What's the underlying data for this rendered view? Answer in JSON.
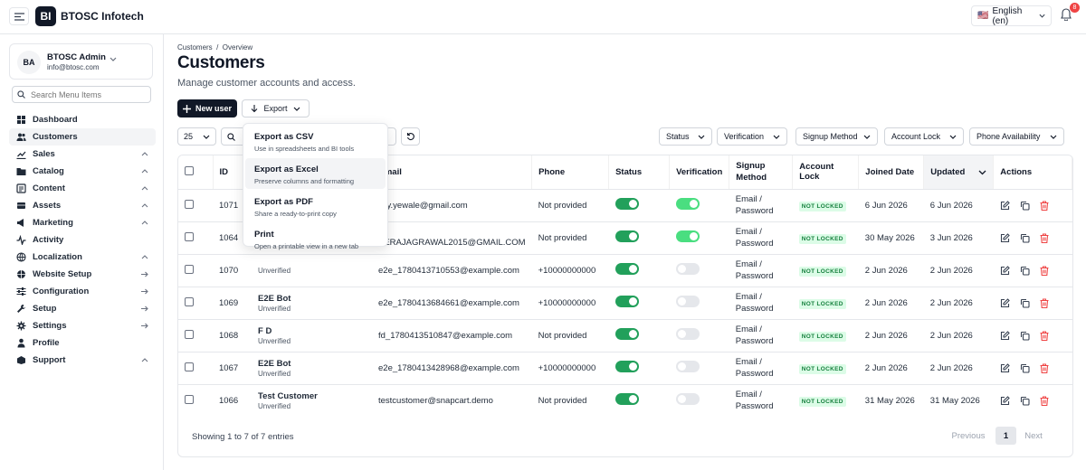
{
  "header": {
    "brand_logo": "BI",
    "brand_name": "BTOSC Infotech",
    "language": "English (en)",
    "flag": "🇺🇸",
    "notification_count": "8"
  },
  "sidebar": {
    "user": {
      "initials": "BA",
      "name": "BTOSC Admin",
      "email": "info@btosc.com"
    },
    "search_placeholder": "Search Menu Items",
    "items": [
      {
        "label": "Dashboard",
        "icon": "dashboard-icon",
        "arrow": ""
      },
      {
        "label": "Customers",
        "icon": "users-icon",
        "arrow": "",
        "active": true
      },
      {
        "label": "Sales",
        "icon": "chart-icon",
        "arrow": "up"
      },
      {
        "label": "Catalog",
        "icon": "folder-icon",
        "arrow": "up"
      },
      {
        "label": "Content",
        "icon": "content-icon",
        "arrow": "up"
      },
      {
        "label": "Assets",
        "icon": "assets-icon",
        "arrow": "up"
      },
      {
        "label": "Marketing",
        "icon": "megaphone-icon",
        "arrow": "up"
      },
      {
        "label": "Activity",
        "icon": "activity-icon",
        "arrow": ""
      },
      {
        "label": "Localization",
        "icon": "globe-icon",
        "arrow": "up"
      },
      {
        "label": "Website Setup",
        "icon": "website-icon",
        "arrow": "right"
      },
      {
        "label": "Configuration",
        "icon": "sliders-icon",
        "arrow": "right"
      },
      {
        "label": "Setup",
        "icon": "wrench-icon",
        "arrow": "right"
      },
      {
        "label": "Settings",
        "icon": "gear-icon",
        "arrow": "right"
      },
      {
        "label": "Profile",
        "icon": "person-icon",
        "arrow": ""
      },
      {
        "label": "Support",
        "icon": "support-icon",
        "arrow": "up"
      }
    ]
  },
  "page": {
    "breadcrumb": "Customers  /  Overview",
    "title": "Customers",
    "subtitle": "Manage customer accounts and access.",
    "new_user_label": "New user",
    "export_label": "Export",
    "per_page": "25",
    "filters": [
      "Status",
      "Verification",
      "Signup Method",
      "Account Lock",
      "Phone Availability"
    ]
  },
  "export_menu": [
    {
      "title": "Export as CSV",
      "desc": "Use in spreadsheets and BI tools"
    },
    {
      "title": "Export as Excel",
      "desc": "Preserve columns and formatting"
    },
    {
      "title": "Export as PDF",
      "desc": "Share a ready-to-print copy"
    },
    {
      "title": "Print",
      "desc": "Open a printable view in a new tab"
    }
  ],
  "table": {
    "columns": [
      "ID",
      "Email",
      "Phone",
      "Status",
      "Verification",
      "Signup Method",
      "Account Lock",
      "Joined Date",
      "Updated",
      "Actions"
    ],
    "rows": [
      {
        "id": "1071",
        "name": "",
        "sub": "",
        "email": "…y.yewale@gmail.com",
        "phone": "Not provided",
        "status": true,
        "verified": true,
        "method": "Email / Password",
        "lock": "NOT LOCKED",
        "joined": "6 Jun 2026",
        "updated": "6 Jun 2026"
      },
      {
        "id": "1064",
        "name": "",
        "sub": "",
        "email": "…EERAJAGRAWAL2015@GMAIL.COM",
        "phone": "Not provided",
        "status": true,
        "verified": true,
        "method": "Email / Password",
        "lock": "NOT LOCKED",
        "joined": "30 May 2026",
        "updated": "3 Jun 2026"
      },
      {
        "id": "1070",
        "name": "",
        "sub": "Unverified",
        "email": "e2e_1780413710553@example.com",
        "phone": "+10000000000",
        "status": true,
        "verified": false,
        "method": "Email / Password",
        "lock": "NOT LOCKED",
        "joined": "2 Jun 2026",
        "updated": "2 Jun 2026"
      },
      {
        "id": "1069",
        "name": "E2E Bot",
        "sub": "Unverified",
        "email": "e2e_1780413684661@example.com",
        "phone": "+10000000000",
        "status": true,
        "verified": false,
        "method": "Email / Password",
        "lock": "NOT LOCKED",
        "joined": "2 Jun 2026",
        "updated": "2 Jun 2026"
      },
      {
        "id": "1068",
        "name": "F D",
        "sub": "Unverified",
        "email": "fd_1780413510847@example.com",
        "phone": "Not provided",
        "status": true,
        "verified": false,
        "method": "Email / Password",
        "lock": "NOT LOCKED",
        "joined": "2 Jun 2026",
        "updated": "2 Jun 2026"
      },
      {
        "id": "1067",
        "name": "E2E Bot",
        "sub": "Unverified",
        "email": "e2e_1780413428968@example.com",
        "phone": "+10000000000",
        "status": true,
        "verified": false,
        "method": "Email / Password",
        "lock": "NOT LOCKED",
        "joined": "2 Jun 2026",
        "updated": "2 Jun 2026"
      },
      {
        "id": "1066",
        "name": "Test Customer",
        "sub": "Unverified",
        "email": "testcustomer@snapcart.demo",
        "phone": "Not provided",
        "status": true,
        "verified": false,
        "method": "Email / Password",
        "lock": "NOT LOCKED",
        "joined": "31 May 2026",
        "updated": "31 May 2026"
      }
    ]
  },
  "footer": {
    "showing": "Showing 1 to 7 of 7 entries",
    "previous": "Previous",
    "current_page": "1",
    "next": "Next"
  }
}
